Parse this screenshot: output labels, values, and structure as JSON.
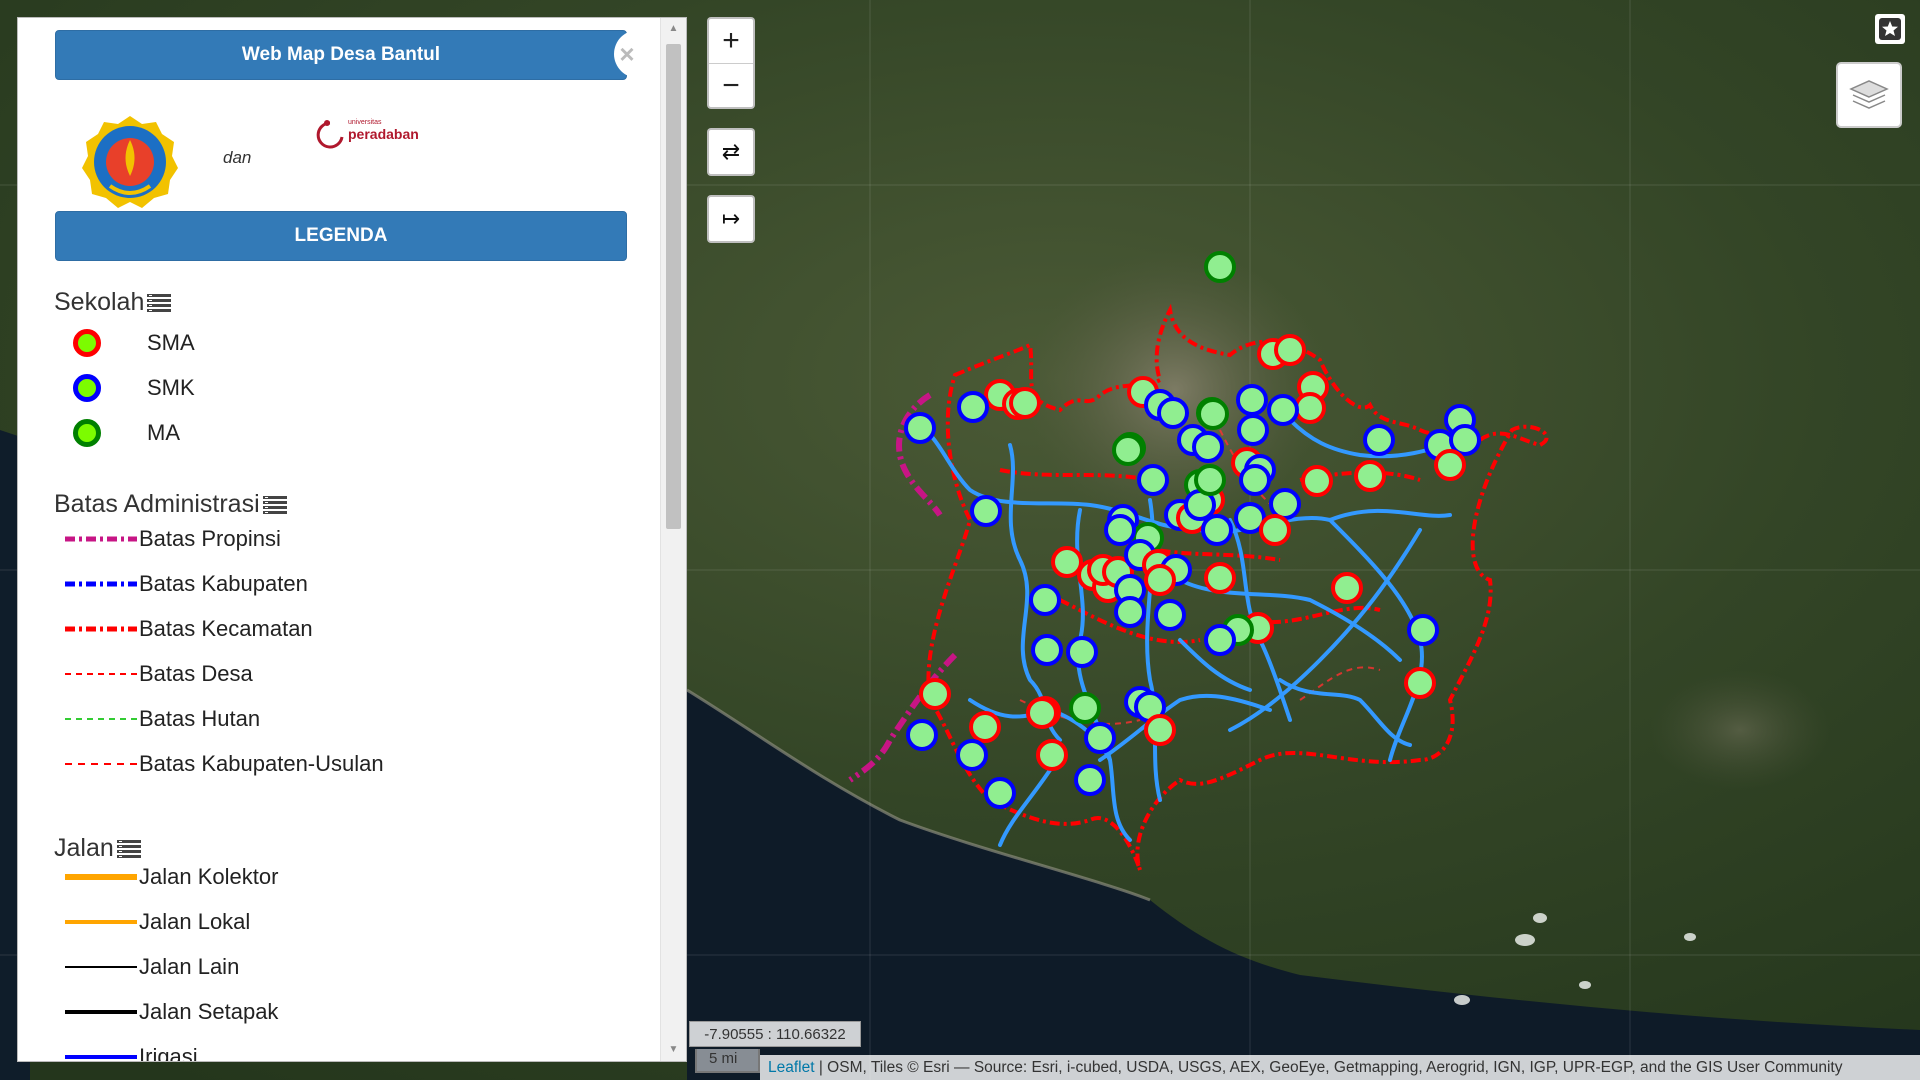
{
  "sidebar": {
    "title": "Web Map Desa Bantul",
    "close_symbol": "×",
    "dan": "dan",
    "partner_logo_small": "universitas",
    "partner_logo_name": "peradaban",
    "legend_button": "LEGENDA",
    "sections": [
      {
        "title": "Sekolah",
        "items": [
          {
            "label": "SMA",
            "icon": "red-ring-green-dot",
            "border": "#ff0000",
            "fill": "#7cfc00"
          },
          {
            "label": "SMK",
            "icon": "blue-ring-green-dot",
            "border": "#0000ff",
            "fill": "#7cfc00"
          },
          {
            "label": "MA",
            "icon": "green-ring-green-dot",
            "border": "#008000",
            "fill": "#7cfc00"
          }
        ]
      },
      {
        "title": "Batas Administrasi",
        "items": [
          {
            "label": "Batas Propinsi",
            "color": "#c71585",
            "style": "dash-dot"
          },
          {
            "label": "Batas Kabupaten",
            "color": "#0000ff",
            "style": "dash-dot"
          },
          {
            "label": "Batas Kecamatan",
            "color": "#ff0000",
            "style": "dash-dot"
          },
          {
            "label": "Batas Desa",
            "color": "#ff0000",
            "style": "dashed-thin"
          },
          {
            "label": "Batas Hutan",
            "color": "#33cc33",
            "style": "dashed-thin"
          },
          {
            "label": "Batas Kabupaten-Usulan",
            "color": "#ff0000",
            "style": "dashed"
          }
        ]
      },
      {
        "title": "Jalan",
        "items": [
          {
            "label": "Jalan Kolektor",
            "color": "#ffa500",
            "style": "solid-thick"
          },
          {
            "label": "Jalan Lokal",
            "color": "#ffa500",
            "style": "solid"
          },
          {
            "label": "Jalan Lain",
            "color": "#000000",
            "style": "solid-thin"
          },
          {
            "label": "Jalan Setapak",
            "color": "#000000",
            "style": "solid"
          },
          {
            "label": "Irigasi",
            "color": "#0000ff",
            "style": "solid"
          }
        ]
      }
    ]
  },
  "map": {
    "zoom_in": "+",
    "zoom_out": "−",
    "swap_symbol": "⇄",
    "expand_symbol": "↦",
    "coordinates": "-7.90555 : 110.66322",
    "scale_label": "5 mi",
    "attribution_link": "Leaflet",
    "attribution_text": " | OSM, Tiles © Esri — Source: Esri, i-cubed, USDA, USGS, AEX, GeoEye, Getmapping, Aerogrid, IGN, IGP, UPR-EGP, and the GIS User Community"
  },
  "colors": {
    "accent": "#337ab7",
    "sma": "#ff0000",
    "smk": "#0000ff",
    "ma": "#008000",
    "school_fill": "#90ee90",
    "river": "#3399ff",
    "kecamatan": "#ff0000",
    "propinsi": "#c71585"
  }
}
